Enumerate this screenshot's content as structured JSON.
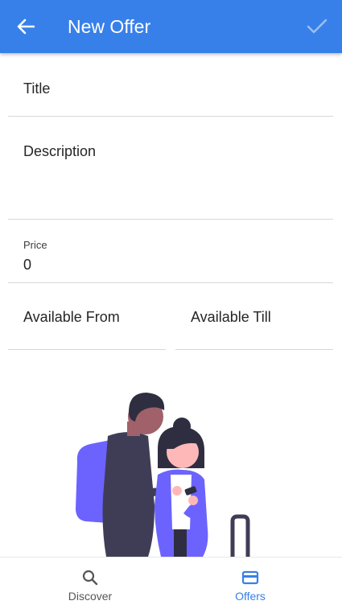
{
  "appbar": {
    "title": "New Offer",
    "back_icon": "arrow-left-icon",
    "confirm_icon": "checkmark-icon",
    "background": "#3880e9"
  },
  "form": {
    "title_placeholder": "Title",
    "description_placeholder": "Description",
    "price_label": "Price",
    "price_value": "0",
    "available_from_placeholder": "Available From",
    "available_till_placeholder": "Available Till"
  },
  "bottom_nav": {
    "items": [
      {
        "label": "Discover",
        "icon": "search-icon",
        "active": false,
        "color": "#555555"
      },
      {
        "label": "Offers",
        "icon": "card-icon",
        "active": true,
        "color": "#3880e9"
      }
    ]
  }
}
